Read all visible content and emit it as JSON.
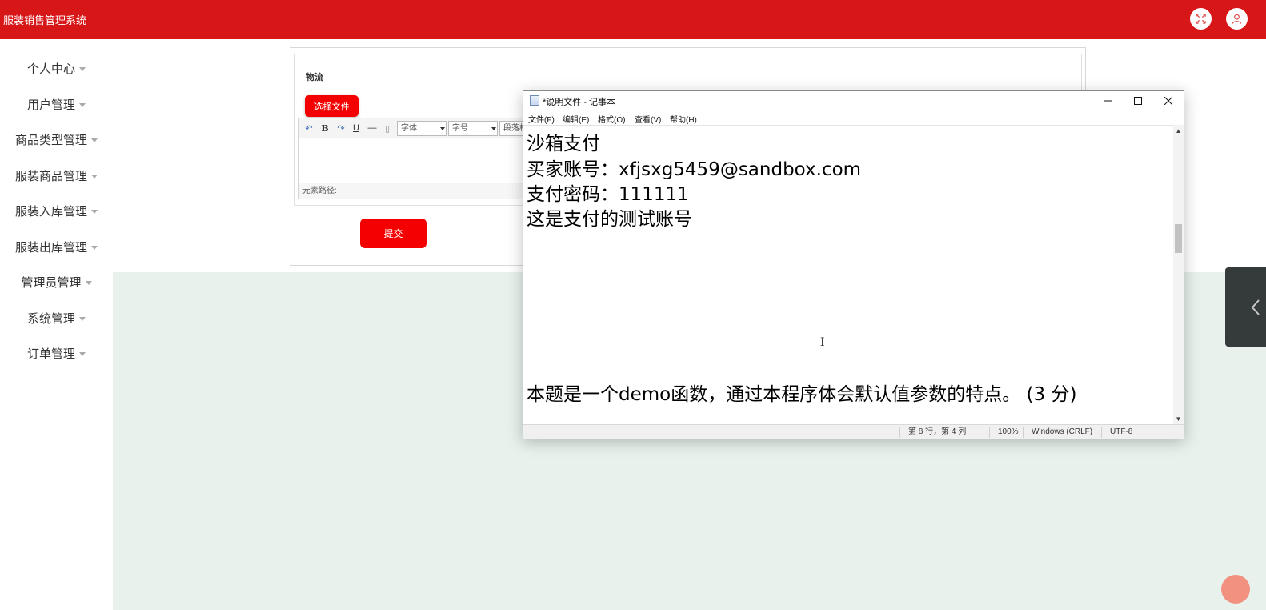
{
  "header": {
    "title": "服装销售管理系统",
    "icons": [
      "fullscreen-icon",
      "user-icon"
    ]
  },
  "sidebar": {
    "items": [
      {
        "label": "个人中心"
      },
      {
        "label": "用户管理"
      },
      {
        "label": "商品类型管理"
      },
      {
        "label": "服装商品管理"
      },
      {
        "label": "服装入库管理"
      },
      {
        "label": "服装出库管理"
      },
      {
        "label": "管理员管理"
      },
      {
        "label": "系统管理"
      },
      {
        "label": "订单管理"
      }
    ]
  },
  "form": {
    "field_label": "物流",
    "file_button": "选择文件",
    "editor": {
      "font_select": "字体",
      "size_select": "字号",
      "para_select": "段落格",
      "path_label": "元素路径:"
    },
    "submit_button": "提交"
  },
  "notepad": {
    "title": "*说明文件 - 记事本",
    "menu": [
      "文件(F)",
      "编辑(E)",
      "格式(O)",
      "查看(V)",
      "帮助(H)"
    ],
    "lines": [
      "沙箱支付",
      "买家账号：xfjsxg5459@sandbox.com",
      "支付密码：111111",
      "这是支付的测试账号",
      "本题是一个demo函数，通过本程序体会默认值参数的特点。 (3 分)"
    ],
    "status": {
      "position": "第 8 行，第 4 列",
      "zoom": "100%",
      "line_ending": "Windows (CRLF)",
      "encoding": "UTF-8"
    }
  },
  "colors": {
    "brand_red": "#d71618",
    "button_red": "#f40000",
    "content_bg": "#e8f1ec",
    "handle_dark": "#353b3a"
  }
}
